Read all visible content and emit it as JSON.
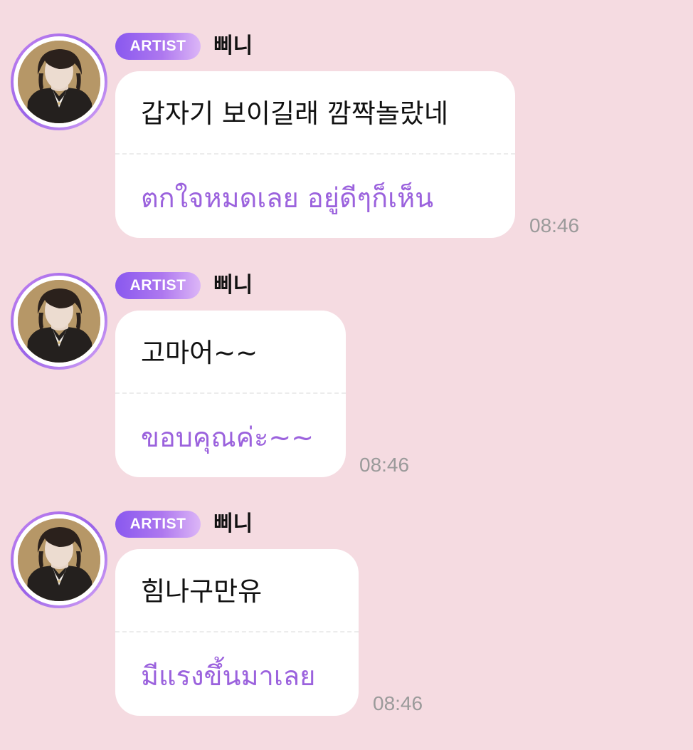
{
  "theme": {
    "background": "#f5dbe1",
    "bubble": "#ffffff",
    "translation_text": "#9b62dd",
    "badge_start": "#8958ef",
    "badge_end": "#dcb6f7",
    "timestamp": "#9a9a9a"
  },
  "messages": [
    {
      "badge": "ARTIST",
      "sender": "삐니",
      "avatar_icon": "profile-photo",
      "original": "갑자기 보이길래 깜짝놀랐네",
      "translation": "ตกใจหมดเลย อยู่ดีๆก็เห็น",
      "time": "08:46"
    },
    {
      "badge": "ARTIST",
      "sender": "삐니",
      "avatar_icon": "profile-photo",
      "original": "고마어~~",
      "translation": "ขอบคุณค่ะ~~",
      "time": "08:46"
    },
    {
      "badge": "ARTIST",
      "sender": "삐니",
      "avatar_icon": "profile-photo",
      "original": "힘나구만유",
      "translation": "มีแรงขึ้นมาเลย",
      "time": "08:46"
    }
  ]
}
